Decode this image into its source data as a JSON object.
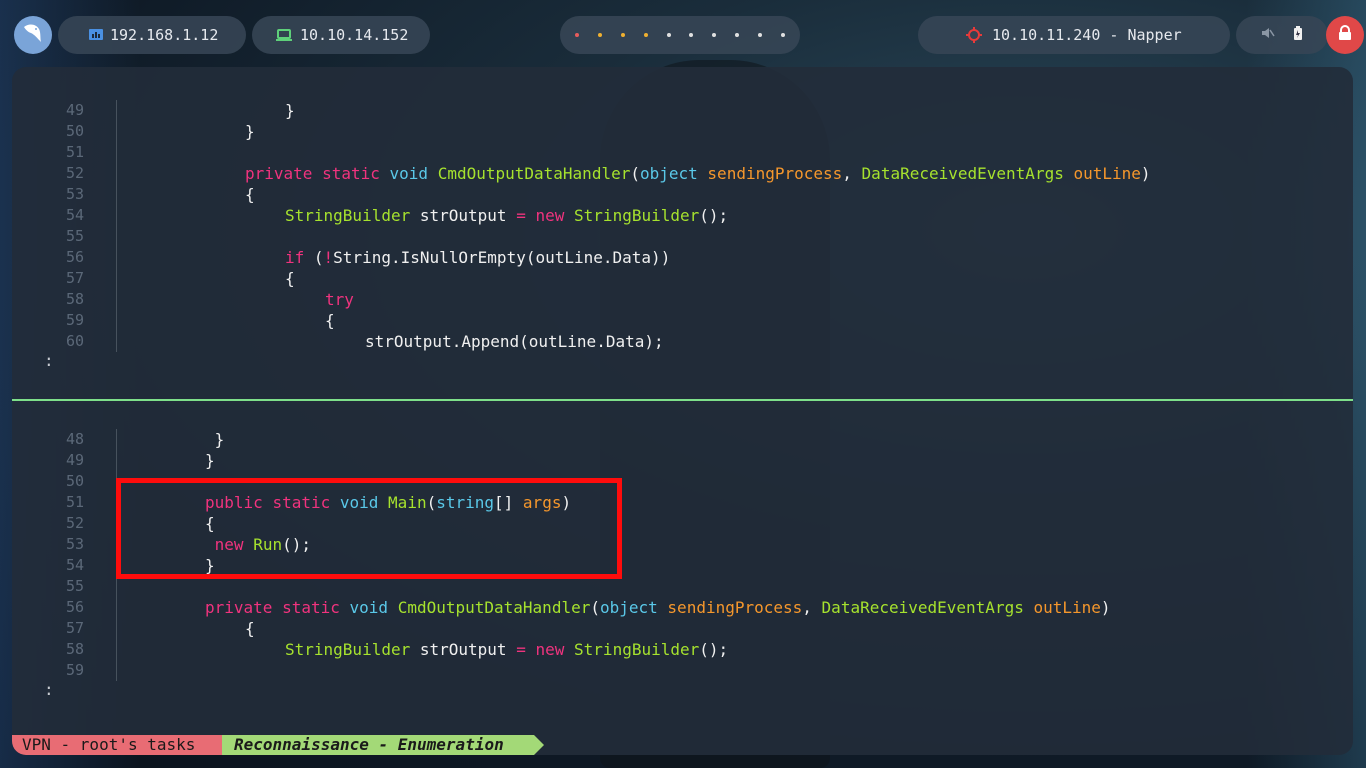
{
  "topbar": {
    "ip_local": "192.168.1.12",
    "ip_vpn": "10.10.14.152",
    "target": "10.10.11.240 - Napper",
    "workspace_dot_colors": [
      "#e85c5c",
      "#f0b030",
      "#f0b030",
      "#f0b030",
      "#e0e0e0",
      "#e0e0e0",
      "#e0e0e0",
      "#e0e0e0",
      "#e0e0e0",
      "#e0e0e0"
    ],
    "icons": [
      "bird-logo-icon",
      "network-icon",
      "laptop-icon",
      "crosshair-icon",
      "volume-mute-icon",
      "battery-icon",
      "lock-icon"
    ]
  },
  "top_pane": {
    "lines": [
      {
        "num": "49",
        "indent": 4,
        "tokens": [
          [
            "w",
            "}"
          ]
        ]
      },
      {
        "num": "50",
        "indent": 3,
        "tokens": [
          [
            "w",
            "}"
          ]
        ]
      },
      {
        "num": "51",
        "indent": 0,
        "tokens": []
      },
      {
        "num": "52",
        "indent": 3,
        "tokens": [
          [
            "k",
            "private"
          ],
          [
            "w",
            " "
          ],
          [
            "k",
            "static"
          ],
          [
            "w",
            " "
          ],
          [
            "t",
            "void"
          ],
          [
            "w",
            " "
          ],
          [
            "g",
            "CmdOutputDataHandler"
          ],
          [
            "w",
            "("
          ],
          [
            "t",
            "object"
          ],
          [
            "w",
            " "
          ],
          [
            "o",
            "sendingProcess"
          ],
          [
            "w",
            ", "
          ],
          [
            "g",
            "DataReceivedEventArgs"
          ],
          [
            "w",
            " "
          ],
          [
            "o",
            "outLine"
          ],
          [
            "w",
            ")"
          ]
        ]
      },
      {
        "num": "53",
        "indent": 3,
        "tokens": [
          [
            "w",
            "{"
          ]
        ]
      },
      {
        "num": "54",
        "indent": 4,
        "tokens": [
          [
            "g",
            "StringBuilder"
          ],
          [
            "w",
            " strOutput "
          ],
          [
            "k",
            "="
          ],
          [
            "w",
            " "
          ],
          [
            "k",
            "new"
          ],
          [
            "w",
            " "
          ],
          [
            "g",
            "StringBuilder"
          ],
          [
            "w",
            "();"
          ]
        ]
      },
      {
        "num": "55",
        "indent": 0,
        "tokens": []
      },
      {
        "num": "56",
        "indent": 4,
        "tokens": [
          [
            "k",
            "if"
          ],
          [
            "w",
            " ("
          ],
          [
            "k",
            "!"
          ],
          [
            "w",
            "String.IsNullOrEmpty(outLine.Data))"
          ]
        ]
      },
      {
        "num": "57",
        "indent": 4,
        "tokens": [
          [
            "w",
            "{"
          ]
        ]
      },
      {
        "num": "58",
        "indent": 5,
        "tokens": [
          [
            "k",
            "try"
          ]
        ]
      },
      {
        "num": "59",
        "indent": 5,
        "tokens": [
          [
            "w",
            "{"
          ]
        ]
      },
      {
        "num": "60",
        "indent": 6,
        "tokens": [
          [
            "w",
            "strOutput.Append(outLine.Data);"
          ]
        ]
      }
    ],
    "prompt": ":"
  },
  "bottom_pane": {
    "lines": [
      {
        "num": "48",
        "indent": 2,
        "pre": " ",
        "tokens": [
          [
            "w",
            "}"
          ]
        ]
      },
      {
        "num": "49",
        "indent": 2,
        "tokens": [
          [
            "w",
            "}"
          ]
        ]
      },
      {
        "num": "50",
        "indent": 0,
        "tokens": []
      },
      {
        "num": "51",
        "indent": 2,
        "tokens": [
          [
            "k",
            "public"
          ],
          [
            "w",
            " "
          ],
          [
            "k",
            "static"
          ],
          [
            "w",
            " "
          ],
          [
            "t",
            "void"
          ],
          [
            "w",
            " "
          ],
          [
            "g",
            "Main"
          ],
          [
            "w",
            "("
          ],
          [
            "t",
            "string"
          ],
          [
            "w",
            "[] "
          ],
          [
            "o",
            "args"
          ],
          [
            "w",
            ")"
          ]
        ]
      },
      {
        "num": "52",
        "indent": 2,
        "tokens": [
          [
            "w",
            "{"
          ]
        ]
      },
      {
        "num": "53",
        "indent": 2,
        "pre": " ",
        "tokens": [
          [
            "k",
            "new"
          ],
          [
            "w",
            " "
          ],
          [
            "g",
            "Run"
          ],
          [
            "w",
            "();"
          ]
        ]
      },
      {
        "num": "54",
        "indent": 2,
        "tokens": [
          [
            "w",
            "}"
          ]
        ]
      },
      {
        "num": "55",
        "indent": 0,
        "tokens": []
      },
      {
        "num": "56",
        "indent": 2,
        "tokens": [
          [
            "k",
            "private"
          ],
          [
            "w",
            " "
          ],
          [
            "k",
            "static"
          ],
          [
            "w",
            " "
          ],
          [
            "t",
            "void"
          ],
          [
            "w",
            " "
          ],
          [
            "g",
            "CmdOutputDataHandler"
          ],
          [
            "w",
            "("
          ],
          [
            "t",
            "object"
          ],
          [
            "w",
            " "
          ],
          [
            "o",
            "sendingProcess"
          ],
          [
            "w",
            ", "
          ],
          [
            "g",
            "DataReceivedEventArgs"
          ],
          [
            "w",
            " "
          ],
          [
            "o",
            "outLine"
          ],
          [
            "w",
            ")"
          ]
        ]
      },
      {
        "num": "57",
        "indent": 3,
        "tokens": [
          [
            "w",
            "{"
          ]
        ]
      },
      {
        "num": "58",
        "indent": 4,
        "tokens": [
          [
            "g",
            "StringBuilder"
          ],
          [
            "w",
            " strOutput "
          ],
          [
            "k",
            "="
          ],
          [
            "w",
            " "
          ],
          [
            "k",
            "new"
          ],
          [
            "w",
            " "
          ],
          [
            "g",
            "StringBuilder"
          ],
          [
            "w",
            "();"
          ]
        ]
      },
      {
        "num": "59",
        "indent": 0,
        "tokens": []
      }
    ],
    "prompt": ":"
  },
  "statusbar": {
    "session": "VPN - root's tasks",
    "window": "Reconnaissance - Enumeration"
  }
}
